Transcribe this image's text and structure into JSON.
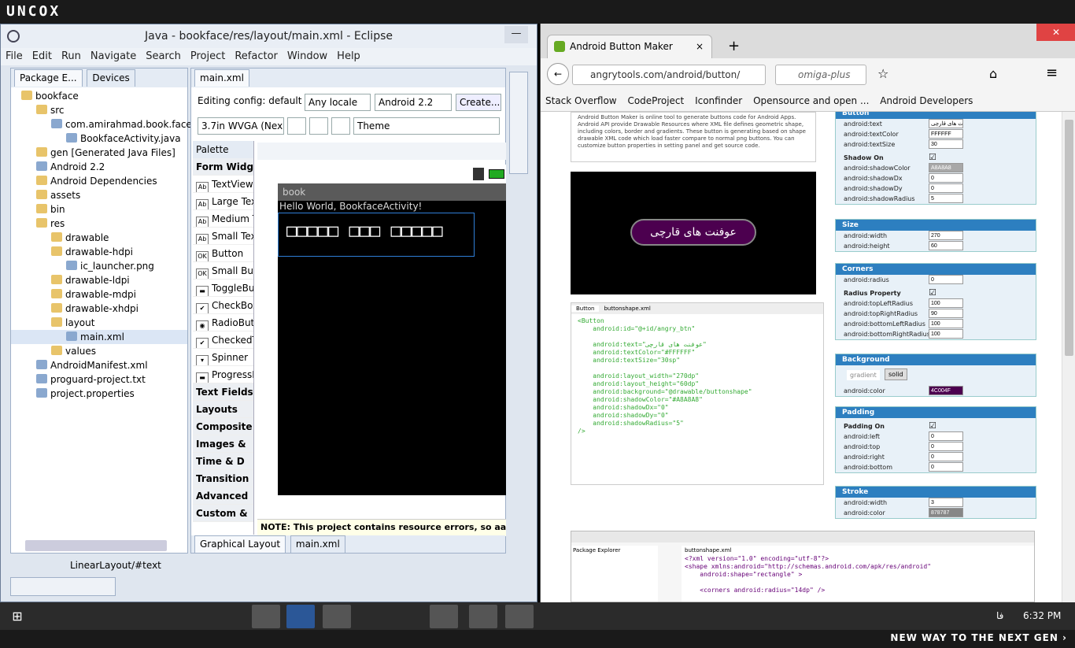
{
  "top_logo": "UNCOX",
  "bottom_slogan": "NEW WAY TO THE NEXT GEN ›",
  "eclipse": {
    "title": "Java - bookface/res/layout/main.xml - Eclipse",
    "menu": [
      "File",
      "Edit",
      "Run",
      "Navigate",
      "Search",
      "Project",
      "Refactor",
      "Window",
      "Help"
    ],
    "left_tabs": [
      "Package E...",
      "Devices"
    ],
    "tree": [
      {
        "label": "bookface",
        "indent": 1
      },
      {
        "label": "src",
        "indent": 2
      },
      {
        "label": "com.amirahmad.book.face",
        "indent": 3
      },
      {
        "label": "BookfaceActivity.java",
        "indent": 4
      },
      {
        "label": "gen [Generated Java Files]",
        "indent": 2
      },
      {
        "label": "Android 2.2",
        "indent": 2
      },
      {
        "label": "Android Dependencies",
        "indent": 2
      },
      {
        "label": "assets",
        "indent": 2
      },
      {
        "label": "bin",
        "indent": 2
      },
      {
        "label": "res",
        "indent": 2
      },
      {
        "label": "drawable",
        "indent": 3
      },
      {
        "label": "drawable-hdpi",
        "indent": 3
      },
      {
        "label": "ic_launcher.png",
        "indent": 4
      },
      {
        "label": "drawable-ldpi",
        "indent": 3
      },
      {
        "label": "drawable-mdpi",
        "indent": 3
      },
      {
        "label": "drawable-xhdpi",
        "indent": 3
      },
      {
        "label": "layout",
        "indent": 3
      },
      {
        "label": "main.xml",
        "indent": 4
      },
      {
        "label": "values",
        "indent": 3
      },
      {
        "label": "AndroidManifest.xml",
        "indent": 2
      },
      {
        "label": "proguard-project.txt",
        "indent": 2
      },
      {
        "label": "project.properties",
        "indent": 2
      }
    ],
    "editor_tab": "main.xml",
    "config_label": "Editing config:",
    "config_value": "default",
    "locale": "Any locale",
    "api": "Android 2.2",
    "create": "Create...",
    "device": "3.7in WVGA (Nex",
    "theme": "Theme",
    "palette_title": "Palette",
    "palette": [
      {
        "label": "Form Widg",
        "cat": true
      },
      {
        "label": "TextView",
        "icon": "Ab"
      },
      {
        "label": "Large Tex",
        "icon": "Ab"
      },
      {
        "label": "Medium T",
        "icon": "Ab"
      },
      {
        "label": "Small Tex",
        "icon": "Ab"
      },
      {
        "label": "Button",
        "icon": "OK"
      },
      {
        "label": "Small Butt",
        "icon": "OK"
      },
      {
        "label": "ToggleBut",
        "icon": "▬"
      },
      {
        "label": "CheckBox",
        "icon": "✔"
      },
      {
        "label": "RadioButt",
        "icon": "◉"
      },
      {
        "label": "CheckedT",
        "icon": "✔"
      },
      {
        "label": "Spinner",
        "icon": "▾"
      },
      {
        "label": "ProgressB",
        "icon": "▬"
      },
      {
        "label": "Text Fields",
        "cat": true
      },
      {
        "label": "Layouts",
        "cat": true
      },
      {
        "label": "Composite",
        "cat": true
      },
      {
        "label": "Images &",
        "cat": true
      },
      {
        "label": "Time & D",
        "cat": true
      },
      {
        "label": "Transition",
        "cat": true
      },
      {
        "label": "Advanced",
        "cat": true
      },
      {
        "label": "Custom &",
        "cat": true
      }
    ],
    "device_appname": "book",
    "device_hello": "Hello World, BookfaceActivity!",
    "device_button": "□□□□□ □□□ □□□□□",
    "error_note": "NOTE: This project contains resource errors, so aapt did n",
    "bottom_tabs": [
      "Graphical Layout",
      "main.xml"
    ],
    "status": "LinearLayout/#text"
  },
  "firefox": {
    "tab_title": "Android Button Maker",
    "url": "angrytools.com/android/button/",
    "search_placeholder": "omiga-plus",
    "bookmarks": [
      "Stack Overflow",
      "CodeProject",
      "Iconfinder",
      "Opensource and open ...",
      "Android Developers"
    ],
    "intro": "Android Button Maker is online tool to generate buttons code for Android Apps. Android API provide Drawable Resources where XML file defines geometric shape, including colors, border and gradients. These button is generating based on shape drawable XML code which load faster compare to normal png buttons. You can customize button properties in setting panel and get source code.",
    "preview_button": "عوفنت های قارچی",
    "code_tabs": [
      "Button",
      "buttonshape.xml"
    ],
    "code": [
      "<Button",
      "    android:id=\"@+id/angry_btn\"",
      "",
      "    android:text=\"عوفنت های قارچی\"",
      "    android:textColor=\"#FFFFFF\"",
      "    android:textSize=\"30sp\"",
      "",
      "    android:layout_width=\"270dp\"",
      "    android:layout_height=\"60dp\"",
      "    android:background=\"@drawable/buttonshape\"",
      "    android:shadowColor=\"#A8A8A8\"",
      "    android:shadowDx=\"0\"",
      "    android:shadowDy=\"0\"",
      "    android:shadowRadius=\"5\"",
      "/>"
    ],
    "panel": {
      "button_head": "Button",
      "text": "عوفنت های قارچی",
      "textColor": "FFFFFF",
      "textSize": "30",
      "shadow_on": "Shadow On",
      "shadowColor": "A8A8A8",
      "shadowDx": "0",
      "shadowDy": "0",
      "shadowRadius": "5",
      "size_head": "Size",
      "width": "270",
      "height": "60",
      "corners_head": "Corners",
      "radius": "0",
      "radius_property": "Radius Property",
      "topLeft": "100",
      "topRight": "90",
      "bottomLeft": "100",
      "bottomRight": "100",
      "background_head": "Background",
      "gradient": "gradient",
      "solid": "solid",
      "bgcolor": "4C004F",
      "padding_head": "Padding",
      "padding_on": "Padding On",
      "left": "0",
      "top": "0",
      "right": "0",
      "bottom": "0",
      "stroke_head": "Stroke",
      "stroke_width": "3",
      "stroke_color": "878787"
    },
    "shot_tab": "buttonshape.xml",
    "shot_pkg": "Package Explorer",
    "shot_code": [
      "<?xml version=\"1.0\" encoding=\"utf-8\"?>",
      "<shape xmlns:android=\"http://schemas.android.com/apk/res/android\"",
      "    android:shape=\"rectangle\" >",
      "",
      "    <corners android:radius=\"14dp\" />"
    ]
  },
  "taskbar": {
    "time": "6:32 PM",
    "lang": "فا"
  },
  "colors": {
    "button_bg": "#4c004f",
    "panel_head": "#2d7fc0",
    "selection": "#2f7fd8"
  }
}
